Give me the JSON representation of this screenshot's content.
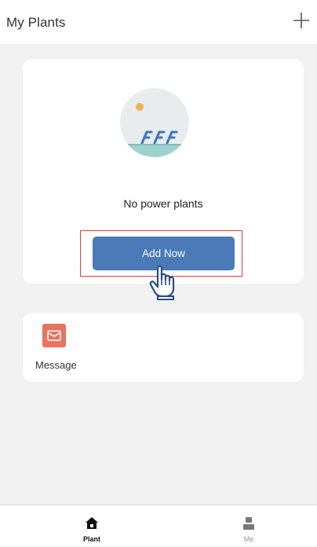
{
  "header": {
    "title": "My Plants",
    "add_icon": "plus-icon"
  },
  "plant_card": {
    "illustration_icon": "solar-plant-illustration-icon",
    "empty_text": "No power plants",
    "add_now_label": "Add Now",
    "pointer_icon": "hand-pointer-icon"
  },
  "message_card": {
    "icon": "message-icon",
    "label": "Message",
    "icon_color": "#e8735f"
  },
  "bottom_nav": {
    "items": [
      {
        "label": "Plant",
        "icon": "home-icon",
        "active": true
      },
      {
        "label": "Me",
        "icon": "user-icon",
        "active": false
      }
    ]
  },
  "colors": {
    "accent": "#4a7ab8",
    "highlight": "#e23a3a",
    "background": "#f1f1f1"
  }
}
